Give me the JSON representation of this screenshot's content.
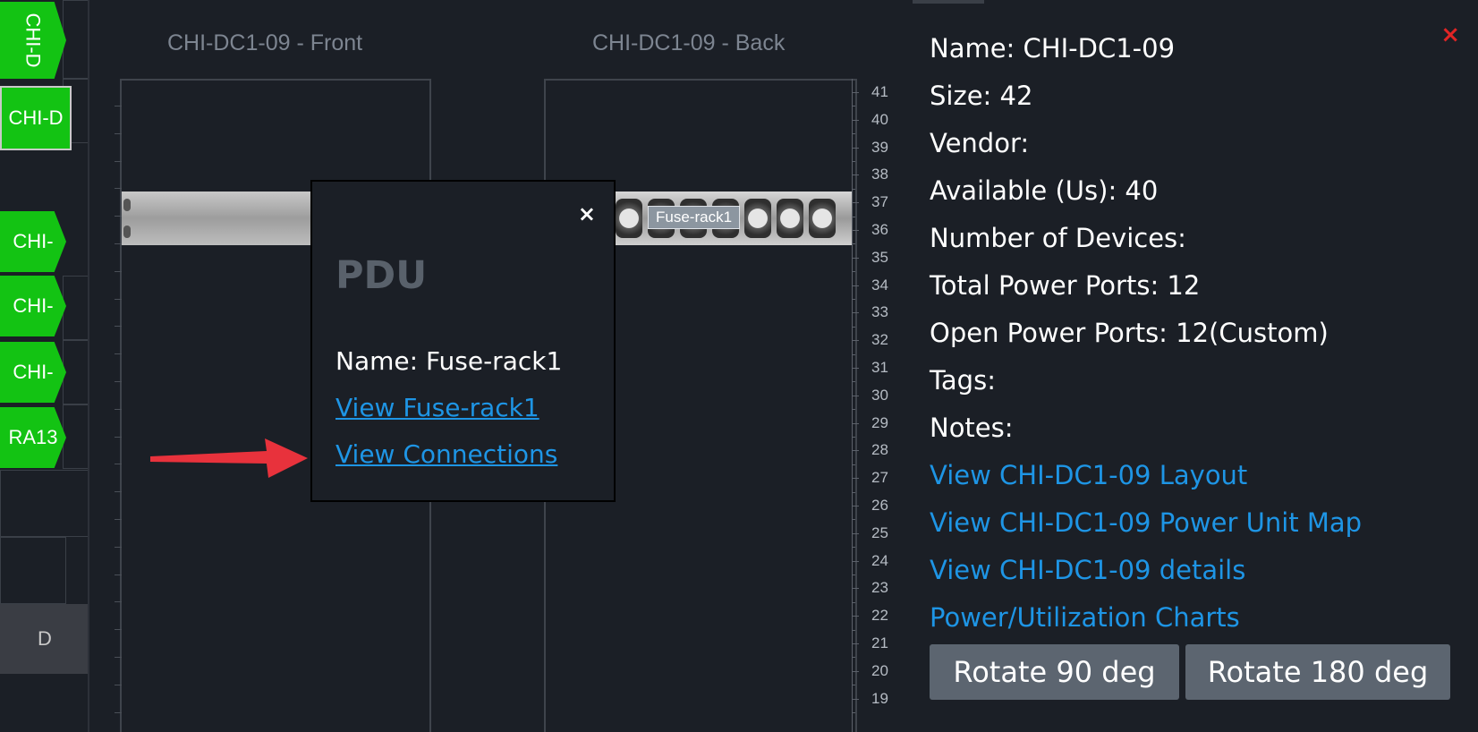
{
  "floor": {
    "tiles": [
      "CHI-D",
      "CHI-D",
      "CHI-",
      "CHI-",
      "CHI-",
      "RA13"
    ],
    "bottom_label": "D"
  },
  "elevation": {
    "front_title": "CHI-DC1-09 - Front",
    "back_title": "CHI-DC1-09 - Back",
    "device_label": "Fuse-rack1",
    "unit_numbers": [
      "41",
      "40",
      "39",
      "38",
      "37",
      "36",
      "35",
      "34",
      "33",
      "32",
      "31",
      "30",
      "29",
      "28",
      "27",
      "26",
      "25",
      "24",
      "23",
      "22",
      "21",
      "20",
      "19"
    ]
  },
  "popup": {
    "close": "×",
    "title": "PDU",
    "name": "Name: Fuse-rack1",
    "link_view": "View Fuse-rack1",
    "link_connections": "View Connections"
  },
  "info": {
    "close": "×",
    "rows": [
      "Name: CHI-DC1-09",
      "Size: 42",
      "Vendor:",
      "Available (Us): 40",
      "Number of Devices:",
      "Total Power Ports: 12",
      "Open Power Ports: 12(Custom)",
      "Tags:",
      "Notes:"
    ],
    "links": [
      "View CHI-DC1-09 Layout",
      "View CHI-DC1-09 Power Unit Map",
      "View CHI-DC1-09 details",
      "Power/Utilization Charts"
    ],
    "rotate90": "Rotate 90 deg",
    "rotate180": "Rotate 180 deg"
  },
  "colors": {
    "accent_link": "#1e95e5",
    "rack_tile": "#13c313",
    "close_red": "#e22525",
    "arrow": "#e8323c"
  }
}
